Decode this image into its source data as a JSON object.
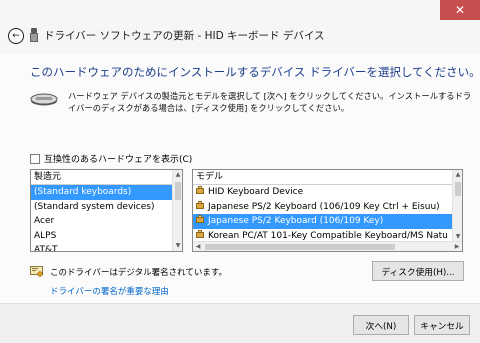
{
  "window": {
    "title": "ドライバー ソフトウェアの更新 - HID キーボード デバイス",
    "close_glyph": "✕",
    "back_glyph": "←"
  },
  "heading": "このハードウェアのためにインストールするデバイス ドライバーを選択してください。",
  "description": "ハードウェア デバイスの製造元とモデルを選択して [次へ] をクリックしてください。インストールするドライバーのディスクがある場合は、[ディスク使用] をクリックしてください。",
  "compat_checkbox": {
    "label": "互換性のあるハードウェアを表示(C)",
    "checked": false
  },
  "manufacturer_list": {
    "header": "製造元",
    "items": [
      "(Standard keyboards)",
      "(Standard system devices)",
      "Acer",
      "ALPS",
      "AT&T"
    ],
    "selected_index": 0
  },
  "model_list": {
    "header": "モデル",
    "items": [
      "HID Keyboard Device",
      "Japanese PS/2 Keyboard (106/109 Key Ctrl + Eisuu)",
      "Japanese PS/2 Keyboard (106/109 Key)",
      "Korean PC/AT 101-Key Compatible Keyboard/MS Natu"
    ],
    "selected_index": 2
  },
  "signature": {
    "text": "このドライバーはデジタル署名されています。",
    "link": "ドライバーの署名が重要な理由"
  },
  "buttons": {
    "have_disk": "ディスク使用(H)...",
    "next": "次へ(N)",
    "cancel": "キャンセル"
  },
  "icons": {
    "back": "back-arrow-icon",
    "title": "usb-device-icon",
    "hardware": "keyboard-device-icon",
    "driver": "driver-package-icon",
    "signature": "signed-driver-icon"
  },
  "colors": {
    "heading": "#1c3c8c",
    "link": "#0066cc",
    "selection": "#3399ff",
    "close_button": "#c74f4f"
  }
}
